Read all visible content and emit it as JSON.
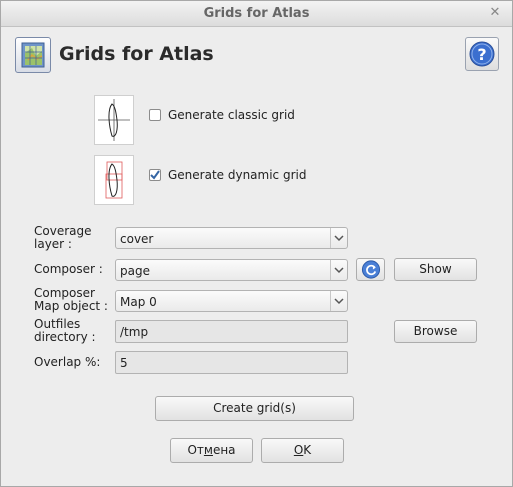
{
  "window": {
    "title": "Grids for Atlas"
  },
  "header": {
    "title": "Grids for Atlas"
  },
  "options": {
    "classic": {
      "label": "Generate classic grid",
      "checked": false
    },
    "dynamic": {
      "label": "Generate dynamic grid",
      "checked": true
    }
  },
  "form": {
    "coverage": {
      "label_line1": "Coverage",
      "label_line2": "layer :",
      "value": "cover"
    },
    "composer": {
      "label": "Composer :",
      "value": "page",
      "show_label": "Show"
    },
    "map_object": {
      "label_line1": "Composer",
      "label_line2": "Map object :",
      "value": "Map 0"
    },
    "outfiles": {
      "label_line1": "Outfiles",
      "label_line2": "directory :",
      "value": "/tmp",
      "browse_label": "Browse"
    },
    "overlap": {
      "label": "Overlap %:",
      "value": "5"
    }
  },
  "actions": {
    "create_label": "Create grid(s)",
    "cancel_pre": "От",
    "cancel_mnemonic": "м",
    "cancel_post": "ена",
    "ok_mnemonic": "O",
    "ok_post": "K"
  },
  "colors": {
    "accent": "#3b6fcf",
    "check_mark": "#3465a4"
  },
  "icons": {
    "close": "close-icon",
    "app": "atlas-grid-icon",
    "help": "help-icon",
    "refresh": "refresh-icon",
    "dropdown": "chevron-down-icon"
  }
}
